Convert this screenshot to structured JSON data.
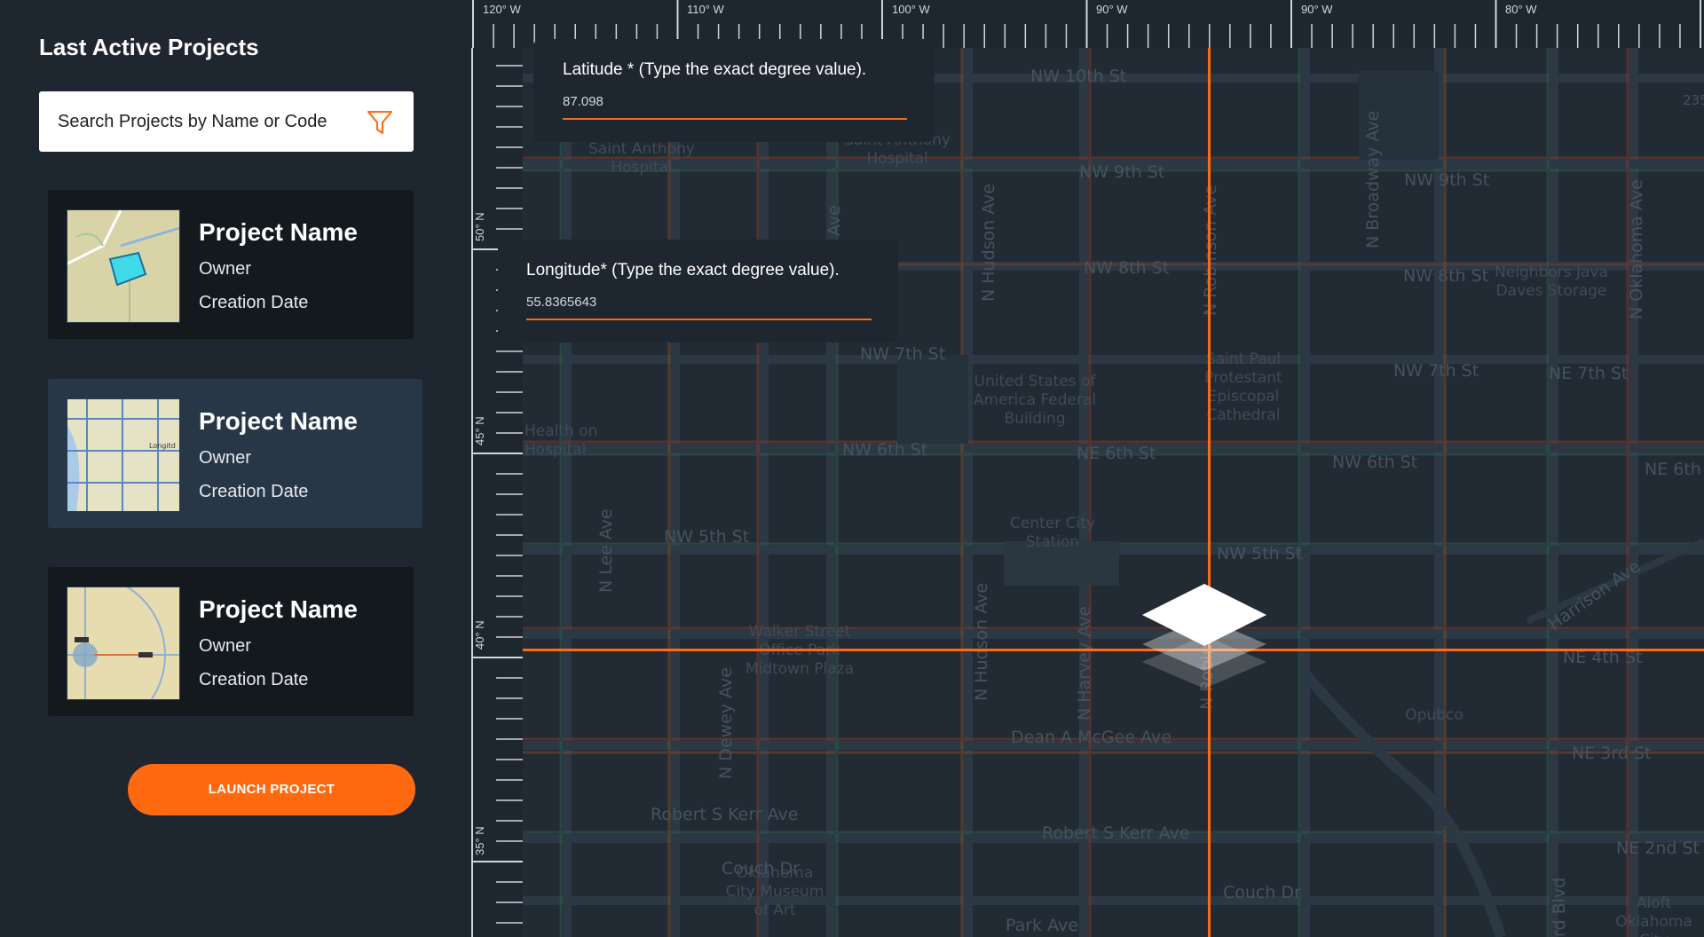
{
  "sidebar": {
    "title": "Last Active Projects",
    "search_placeholder": "Search Projects by Name or Code",
    "projects": [
      {
        "name": "Project Name",
        "owner": "Owner",
        "date": "Creation Date"
      },
      {
        "name": "Project Name",
        "owner": "Owner",
        "date": "Creation Date"
      },
      {
        "name": "Project Name",
        "owner": "Owner",
        "date": "Creation Date"
      }
    ],
    "launch_label": "LAUNCH PROJECT"
  },
  "coords": {
    "latitude_label": "Latitude * (Type the exact degree value).",
    "latitude_value": "87.098",
    "longitude_label": "Longitude* (Type the exact degree value).",
    "longitude_value": "55.8365643"
  },
  "ruler": {
    "top_labels": [
      "120° W",
      "110° W",
      "100° W",
      "90° W",
      "90° W",
      "80° W"
    ],
    "left_labels": [
      "50° N",
      "45° N",
      "40° N",
      "35° N"
    ]
  },
  "map_labels": [
    "NW 10th St",
    "NW 9th St",
    "NW 9th St",
    "NW 8th St",
    "NW 8th St",
    "NW 7th St",
    "NW 7th St",
    "NE 7th St",
    "NW 6th St",
    "NE 6th St",
    "NW 6th St",
    "NE 6th",
    "NW 5th St",
    "NW 5th St",
    "NE 4th St",
    "NE 3rd St",
    "NE 2nd St",
    "Dean A McGee Ave",
    "Robert S Kerr Ave",
    "Robert S Kerr Ave",
    "Couch Dr",
    "Couch Dr",
    "Park Ave",
    "Saint Anthony Hospital",
    "Saint Anthony Hospital",
    "United States of America Federal Building",
    "Saint Paul Protestant Episcopal Cathedral",
    "Neighbors Java Daves Storage",
    "Center City Station",
    "Walker Street Office Park Midtown Plaza",
    "Oklahoma City Museum of Art",
    "Opubco",
    "Health on Hospital",
    "Aloft Oklahoma City Downtown",
    "N Hudson Ave",
    "N Robinson Ave",
    "N Broadway Ave",
    "N Oklahoma Ave",
    "N Lee Ave",
    "N Hudson Ave",
    "N Harvey Ave",
    "N Robinson",
    "N Dewey Ave",
    "Harrison Ave",
    "rd Blvd",
    "235",
    "Ave"
  ],
  "colors": {
    "accent": "#ff6a10",
    "sidebar_bg": "#1e262f",
    "card_bg": "#14191e",
    "card_selected_bg": "#283748",
    "map_bg": "#222b33"
  }
}
